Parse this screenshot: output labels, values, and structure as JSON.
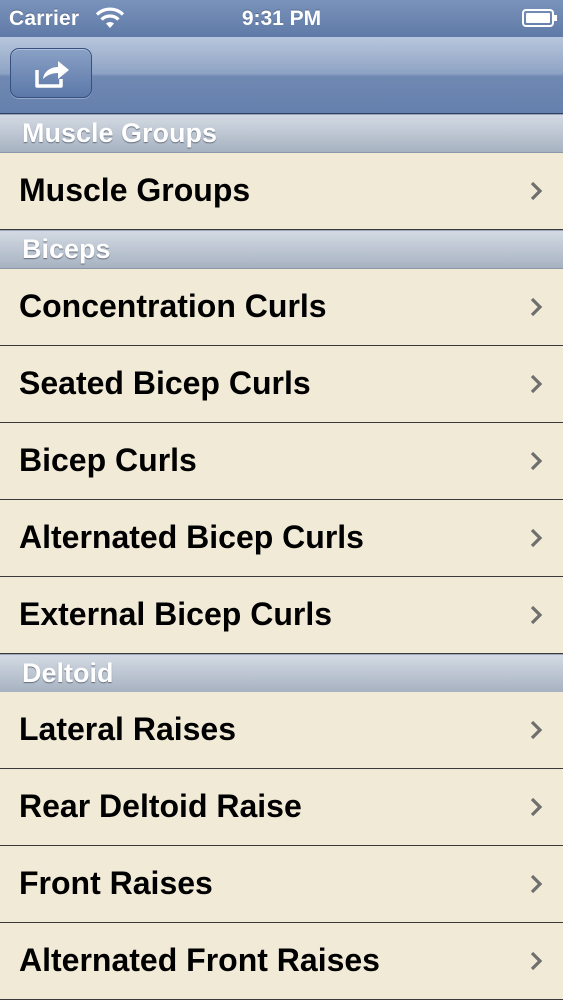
{
  "status_bar": {
    "carrier": "Carrier",
    "time": "9:31 PM",
    "wifi_icon": "wifi-icon",
    "battery_icon": "battery-icon"
  },
  "nav_bar": {
    "share_icon": "share-icon"
  },
  "sections": [
    {
      "title": "Muscle Groups",
      "rows": [
        "Muscle Groups"
      ]
    },
    {
      "title": "Biceps",
      "rows": [
        "Concentration Curls",
        "Seated Bicep Curls",
        "Bicep Curls",
        "Alternated Bicep Curls",
        "External Bicep Curls"
      ]
    },
    {
      "title": "Deltoid",
      "rows": [
        "Lateral Raises",
        "Rear Deltoid Raise",
        "Front Raises",
        "Alternated Front Raises"
      ]
    }
  ],
  "colors": {
    "nav_bar": "#7a91b8",
    "row_background": "#f1ead6",
    "section_header": "#b9c2cf"
  }
}
